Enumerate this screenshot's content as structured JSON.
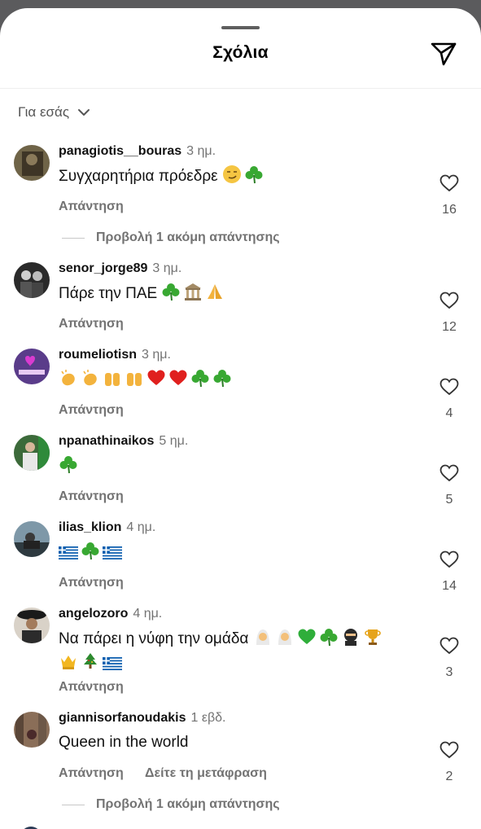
{
  "header": {
    "title": "Σχόλια"
  },
  "filter": {
    "label": "Για εσάς"
  },
  "comments": [
    {
      "user": "panagiotis__bouras",
      "time": "3 ημ.",
      "text": "Συγχαρητήρια πρόεδρε",
      "reply": "Απάντηση",
      "likes": "16",
      "more": "Προβολή 1 ακόμη απάντησης"
    },
    {
      "user": "senor_jorge89",
      "time": "3 ημ.",
      "text": "Πάρε την ΠΑΕ",
      "reply": "Απάντηση",
      "likes": "12"
    },
    {
      "user": "roumeliotisn",
      "time": "3 ημ.",
      "text": "",
      "reply": "Απάντηση",
      "likes": "4"
    },
    {
      "user": "npanathinaikos",
      "time": "5 ημ.",
      "text": "",
      "reply": "Απάντηση",
      "likes": "5"
    },
    {
      "user": "ilias_klion",
      "time": "4 ημ.",
      "text": "",
      "reply": "Απάντηση",
      "likes": "14"
    },
    {
      "user": "angelozoro",
      "time": "4 ημ.",
      "text": "Να πάρει η νύφη την ομάδα",
      "reply": "Απάντηση",
      "likes": "3"
    },
    {
      "user": "giannisorfanoudakis",
      "time": "1 εβδ.",
      "text": "Queen in the world",
      "reply": "Απάντηση",
      "translate": "Δείτε τη μετάφραση",
      "likes": "2",
      "more": "Προβολή 1 ακόμη απάντησης"
    }
  ],
  "icons": {
    "share": "send-icon",
    "like": "heart-icon",
    "filter": "chevron-down-icon"
  }
}
